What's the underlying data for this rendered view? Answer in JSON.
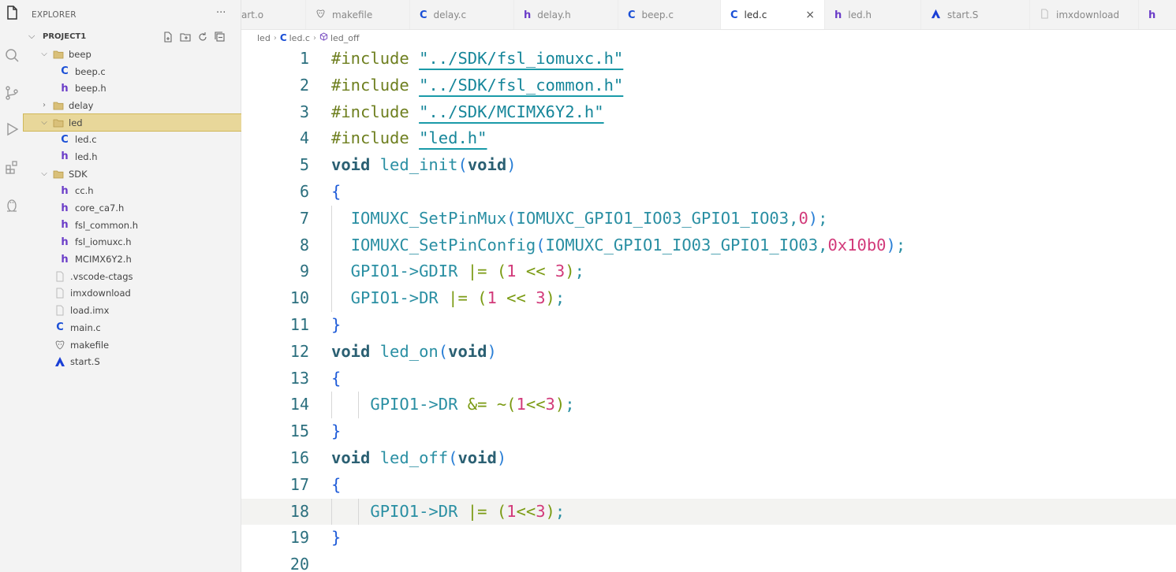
{
  "explorer": {
    "title": "EXPLORER",
    "more": "···",
    "project": "PROJECT1"
  },
  "tree": [
    {
      "label": "beep",
      "kind": "folder",
      "open": true,
      "depth": 0
    },
    {
      "label": "beep.c",
      "kind": "c",
      "depth": 1
    },
    {
      "label": "beep.h",
      "kind": "h",
      "depth": 1
    },
    {
      "label": "delay",
      "kind": "folder",
      "open": false,
      "depth": 0
    },
    {
      "label": "led",
      "kind": "folder",
      "open": true,
      "depth": 0,
      "active": true
    },
    {
      "label": "led.c",
      "kind": "c",
      "depth": 1
    },
    {
      "label": "led.h",
      "kind": "h",
      "depth": 1
    },
    {
      "label": "SDK",
      "kind": "folder",
      "open": true,
      "depth": 0
    },
    {
      "label": "cc.h",
      "kind": "h",
      "depth": 1
    },
    {
      "label": "core_ca7.h",
      "kind": "h",
      "depth": 1
    },
    {
      "label": "fsl_common.h",
      "kind": "h",
      "depth": 1
    },
    {
      "label": "fsl_iomuxc.h",
      "kind": "h",
      "depth": 1
    },
    {
      "label": "MCIMX6Y2.h",
      "kind": "h",
      "depth": 1
    },
    {
      "label": ".vscode-ctags",
      "kind": "file",
      "depth": 0
    },
    {
      "label": "imxdownload",
      "kind": "file",
      "depth": 0
    },
    {
      "label": "load.imx",
      "kind": "file",
      "depth": 0
    },
    {
      "label": "main.c",
      "kind": "c",
      "depth": 0
    },
    {
      "label": "makefile",
      "kind": "gnu",
      "depth": 0
    },
    {
      "label": "start.S",
      "kind": "asm",
      "depth": 0
    }
  ],
  "tabs": [
    {
      "label": "art.o",
      "kind": "none"
    },
    {
      "label": "makefile",
      "kind": "gnu"
    },
    {
      "label": "delay.c",
      "kind": "c"
    },
    {
      "label": "delay.h",
      "kind": "h"
    },
    {
      "label": "beep.c",
      "kind": "c"
    },
    {
      "label": "led.c",
      "kind": "c",
      "active": true,
      "close": "×"
    },
    {
      "label": "led.h",
      "kind": "h"
    },
    {
      "label": "start.S",
      "kind": "asm"
    },
    {
      "label": "imxdownload",
      "kind": "file"
    },
    {
      "label": "",
      "kind": "h"
    }
  ],
  "breadcrumb": {
    "folder": "led",
    "file_icon": "C",
    "file": "led.c",
    "symbol": "led_off"
  },
  "code": {
    "current_line": 18,
    "lines": [
      [
        [
          "pp",
          "#include "
        ],
        [
          "str",
          "\"../SDK/fsl_iomuxc.h\""
        ]
      ],
      [
        [
          "pp",
          "#include "
        ],
        [
          "str",
          "\"../SDK/fsl_common.h\""
        ]
      ],
      [
        [
          "pp",
          "#include "
        ],
        [
          "str",
          "\"../SDK/MCIMX6Y2.h\""
        ]
      ],
      [
        [
          "pp",
          "#include "
        ],
        [
          "str",
          "\"led.h\""
        ]
      ],
      [
        [
          "type",
          "void"
        ],
        [
          "plain",
          " "
        ],
        [
          "fn",
          "led_init"
        ],
        [
          "paren1",
          "("
        ],
        [
          "type",
          "void"
        ],
        [
          "paren1",
          ")"
        ]
      ],
      [
        [
          "brace",
          "{"
        ]
      ],
      [
        [
          "plain",
          "  "
        ],
        [
          "fn",
          "IOMUXC_SetPinMux"
        ],
        [
          "paren1",
          "("
        ],
        [
          "plain",
          "IOMUXC_GPIO1_IO03_GPIO1_IO03,"
        ],
        [
          "num",
          "0"
        ],
        [
          "paren1",
          ")"
        ],
        [
          "plain",
          ";"
        ]
      ],
      [
        [
          "plain",
          "  "
        ],
        [
          "fn",
          "IOMUXC_SetPinConfig"
        ],
        [
          "paren1",
          "("
        ],
        [
          "plain",
          "IOMUXC_GPIO1_IO03_GPIO1_IO03,"
        ],
        [
          "num",
          "0x10b0"
        ],
        [
          "paren1",
          ")"
        ],
        [
          "plain",
          ";"
        ]
      ],
      [
        [
          "plain",
          "  GPIO1->GDIR "
        ],
        [
          "op",
          "|="
        ],
        [
          "plain",
          " "
        ],
        [
          "paren2",
          "("
        ],
        [
          "num",
          "1"
        ],
        [
          "plain",
          " "
        ],
        [
          "op",
          "<<"
        ],
        [
          "plain",
          " "
        ],
        [
          "num",
          "3"
        ],
        [
          "paren2",
          ")"
        ],
        [
          "plain",
          ";"
        ]
      ],
      [
        [
          "plain",
          "  GPIO1->DR "
        ],
        [
          "op",
          "|="
        ],
        [
          "plain",
          " "
        ],
        [
          "paren2",
          "("
        ],
        [
          "num",
          "1"
        ],
        [
          "plain",
          " "
        ],
        [
          "op",
          "<<"
        ],
        [
          "plain",
          " "
        ],
        [
          "num",
          "3"
        ],
        [
          "paren2",
          ")"
        ],
        [
          "plain",
          ";"
        ]
      ],
      [
        [
          "brace",
          "}"
        ]
      ],
      [
        [
          "type",
          "void"
        ],
        [
          "plain",
          " "
        ],
        [
          "fn",
          "led_on"
        ],
        [
          "paren1",
          "("
        ],
        [
          "type",
          "void"
        ],
        [
          "paren1",
          ")"
        ]
      ],
      [
        [
          "brace",
          "{"
        ]
      ],
      [
        [
          "plain",
          "    GPIO1->DR "
        ],
        [
          "op",
          "&="
        ],
        [
          "plain",
          " "
        ],
        [
          "op",
          "~"
        ],
        [
          "paren2",
          "("
        ],
        [
          "num",
          "1"
        ],
        [
          "op",
          "<<"
        ],
        [
          "num",
          "3"
        ],
        [
          "paren2",
          ")"
        ],
        [
          "plain",
          ";"
        ]
      ],
      [
        [
          "brace",
          "}"
        ]
      ],
      [
        [
          "type",
          "void"
        ],
        [
          "plain",
          " "
        ],
        [
          "fn",
          "led_off"
        ],
        [
          "paren1",
          "("
        ],
        [
          "type",
          "void"
        ],
        [
          "paren1",
          ")"
        ]
      ],
      [
        [
          "brace",
          "{"
        ]
      ],
      [
        [
          "plain",
          "    GPIO1->DR "
        ],
        [
          "op",
          "|="
        ],
        [
          "plain",
          " "
        ],
        [
          "paren2",
          "("
        ],
        [
          "num",
          "1"
        ],
        [
          "op",
          "<<"
        ],
        [
          "num",
          "3"
        ],
        [
          "paren2",
          ")"
        ],
        [
          "plain",
          ";"
        ]
      ],
      [
        [
          "brace",
          "}"
        ]
      ],
      []
    ]
  }
}
